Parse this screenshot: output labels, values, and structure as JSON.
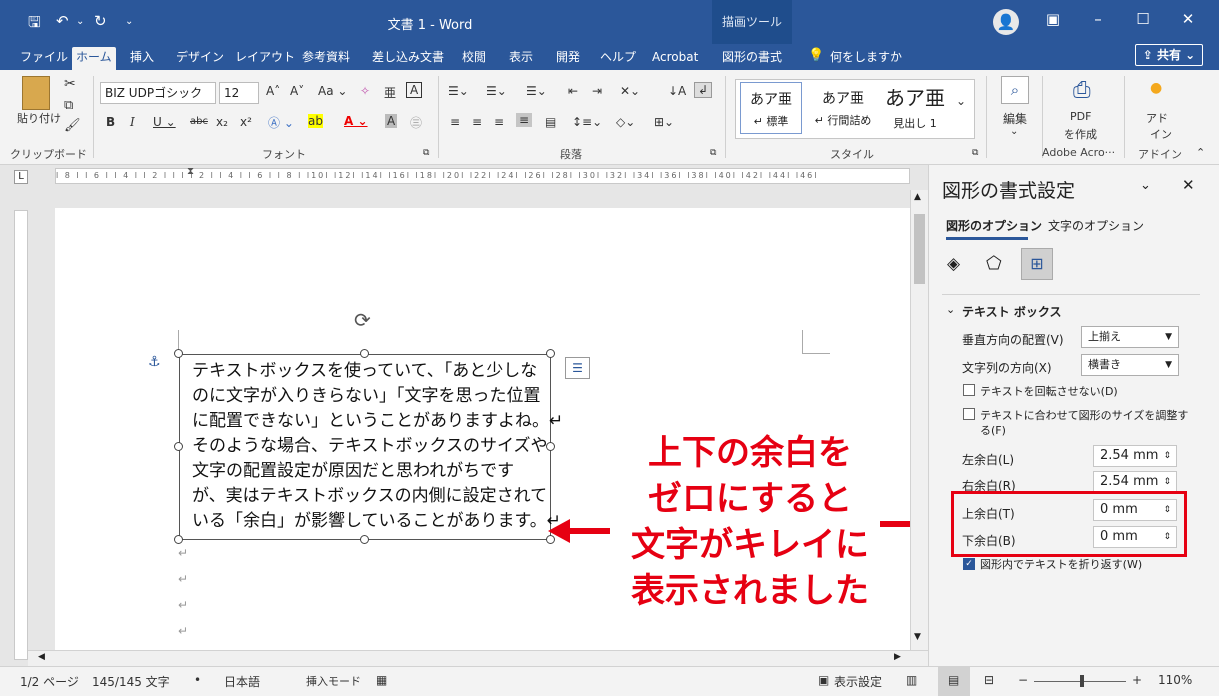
{
  "titlebar": {
    "doc_title": "文書 1 - Word",
    "context_tab": "描画ツール",
    "quick_access": [
      "save-icon",
      "undo-icon",
      "redo-icon",
      "customize-icon"
    ]
  },
  "menu": {
    "items": [
      "ファイル",
      "ホーム",
      "挿入",
      "デザイン",
      "レイアウト",
      "参考資料",
      "差し込み文書",
      "校閲",
      "表示",
      "開発",
      "ヘルプ",
      "Acrobat",
      "図形の書式",
      "何をしますか"
    ],
    "active": "ホーム",
    "share": "共有"
  },
  "ribbon": {
    "clipboard_label": "クリップボード",
    "paste_label": "貼り付け",
    "font_name": "BIZ UDPゴシック",
    "font_size": "12",
    "font_label": "フォント",
    "paragraph_label": "段落",
    "style_label": "スタイル",
    "styles": [
      {
        "preview": "あア亜",
        "name": "↵ 標準"
      },
      {
        "preview": "あア亜",
        "name": "↵ 行間詰め"
      },
      {
        "preview": "あア亜",
        "name": "見出し 1"
      }
    ],
    "edit_label": "編集",
    "pdf_label": "PDF",
    "pdf_sub": "を作成",
    "adobe_label": "Adobe Acro···",
    "addin_label": "アド",
    "addin_sub": "イン",
    "addin_group": "アドイン"
  },
  "ruler_text": "l 8 l  l 6 l  l 4 l  l 2 l  l    l  l 2 l  l 4 l  l 6 l  l 8 l  l10l  l12l  l14l  l16l  l18l  l20l  l22l  l24l  l26l  l28l  l30l  l32l  l34l  l36l  l38l  l40l  l42l  l44l  l46l",
  "document": {
    "textbox_lines": [
      "テキストボックスを使っていて、「あと少しな",
      "のに文字が入りきらない」「文字を思った位置",
      "に配置できない」ということがありますよね。↵",
      "そのような場合、テキストボックスのサイズや",
      "文字の配置設定が原因だと思われがちです",
      "が、実はテキストボックスの内側に設定されて",
      "いる「余白」が影響していることがあります。↵"
    ],
    "callout_lines": [
      "上下の余白を",
      "ゼロにすると",
      "文字がキレイに",
      "表示されました"
    ],
    "para_mark": "↵"
  },
  "pane": {
    "title": "図形の書式設定",
    "tab_shape": "図形のオプション",
    "tab_text": "文字のオプション",
    "section": "テキスト ボックス",
    "valign_label": "垂直方向の配置(V)",
    "valign_value": "上揃え",
    "direction_label": "文字列の方向(X)",
    "direction_value": "横書き",
    "no_rotate": "テキストを回転させない(D)",
    "autofit_line1": "テキストに合わせて図形のサイズを調整す",
    "autofit_line2": "る(F)",
    "left_margin_label": "左余白(L)",
    "left_margin": "2.54 mm",
    "right_margin_label": "右余白(R)",
    "right_margin": "2.54 mm",
    "top_margin_label": "上余白(T)",
    "top_margin": "0 mm",
    "bottom_margin_label": "下余白(B)",
    "bottom_margin": "0 mm",
    "wrap_label": "図形内でテキストを折り返す(W)"
  },
  "status": {
    "page": "1/2 ページ",
    "words": "145/145 文字",
    "lang": "日本語",
    "mode": "挿入モード",
    "display": "表示設定",
    "zoom": "110%"
  },
  "colors": {
    "accent": "#2b579a",
    "highlight": "#e60012"
  }
}
